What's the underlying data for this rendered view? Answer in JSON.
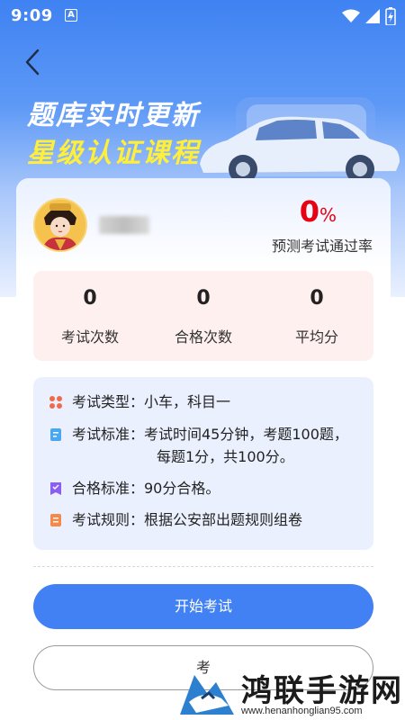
{
  "status_bar": {
    "time": "9:09",
    "a_label": "A"
  },
  "banner": {
    "line1": "题库实时更新",
    "line2": "星级认证课程"
  },
  "user": {
    "pass_rate_value": "0",
    "pass_rate_unit": "%",
    "pass_rate_label": "预测考试通过率"
  },
  "stats": [
    {
      "value": "0",
      "label": "考试次数"
    },
    {
      "value": "0",
      "label": "合格次数"
    },
    {
      "value": "0",
      "label": "平均分"
    }
  ],
  "info": {
    "type": "考试类型：小车，科目一",
    "standard_line1": "考试标准：考试时间45分钟，考题100题，",
    "standard_line2": "每题1分，共100分。",
    "pass": "合格标准：90分合格。",
    "rules": "考试规则：根据公安部出题规则组卷"
  },
  "buttons": {
    "start": "开始考试",
    "second": "考"
  },
  "watermark": {
    "text": "鸿联手游网",
    "url": "www.henanhonglian95.com"
  },
  "colors": {
    "accent": "#4281f4",
    "rate_red": "#e60012",
    "banner_yellow": "#ffef3a"
  }
}
